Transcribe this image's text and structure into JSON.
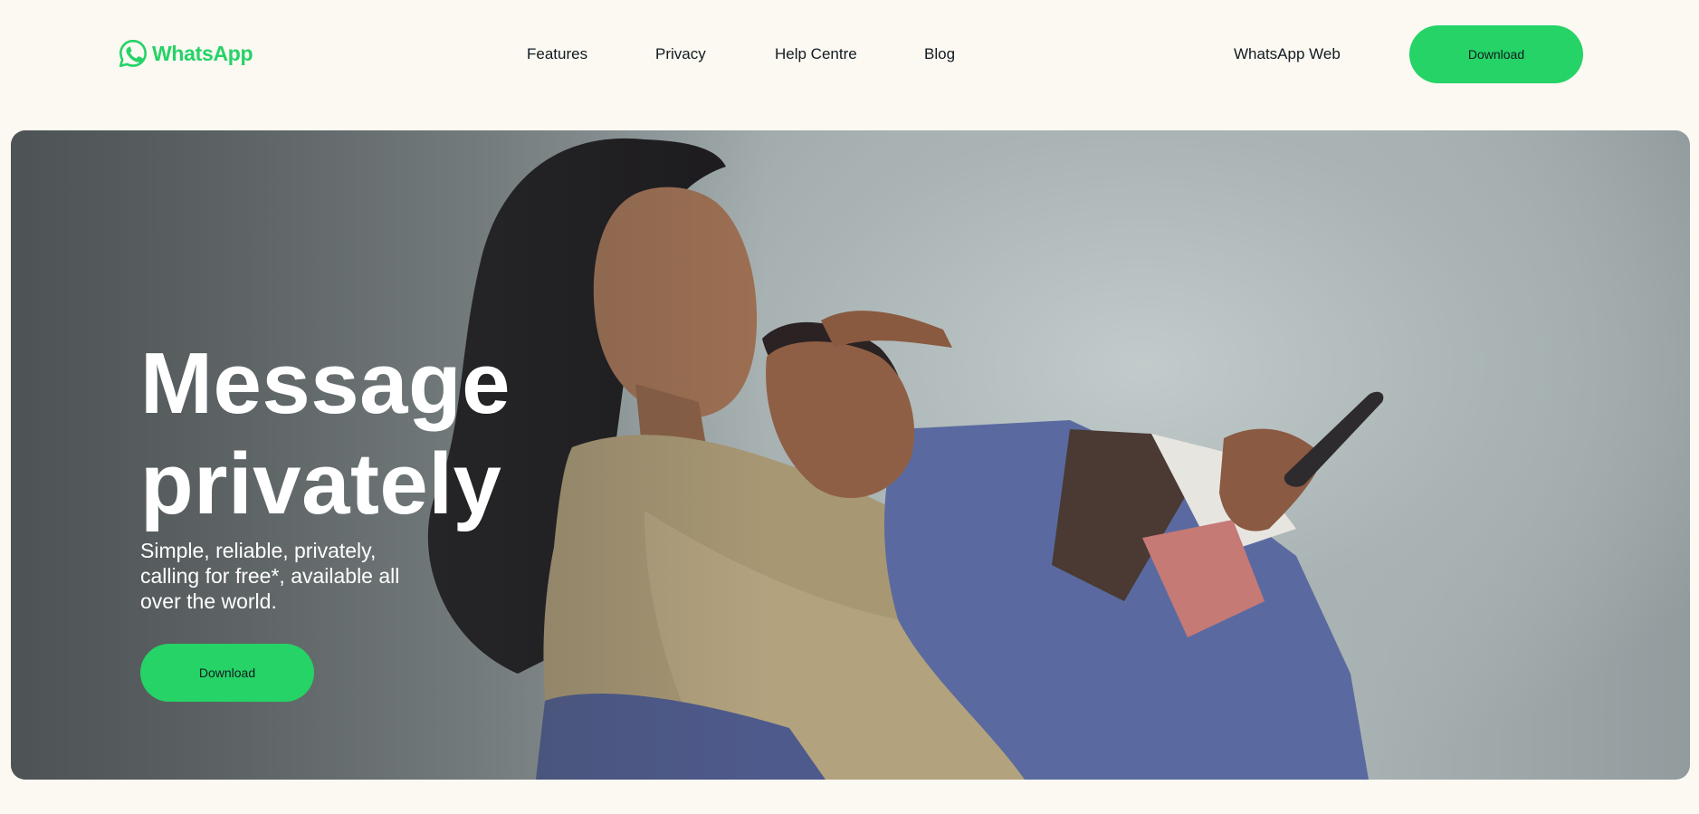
{
  "brand": {
    "name": "WhatsApp",
    "icon": "whatsapp-logo-icon",
    "color": "#25d366"
  },
  "nav": {
    "items": [
      {
        "label": "Features"
      },
      {
        "label": "Privacy"
      },
      {
        "label": "Help Centre"
      },
      {
        "label": "Blog"
      }
    ],
    "web_link": "WhatsApp Web",
    "download_label": "Download"
  },
  "hero": {
    "title_line1": "Message",
    "title_line2": "privately",
    "subtitle": "Simple, reliable, privately, calling for free*, available all over the world.",
    "download_label": "Download"
  },
  "colors": {
    "page_background": "#fcf8f2",
    "accent": "#25d366",
    "text_dark": "#111b21",
    "hero_text": "#ffffff"
  }
}
